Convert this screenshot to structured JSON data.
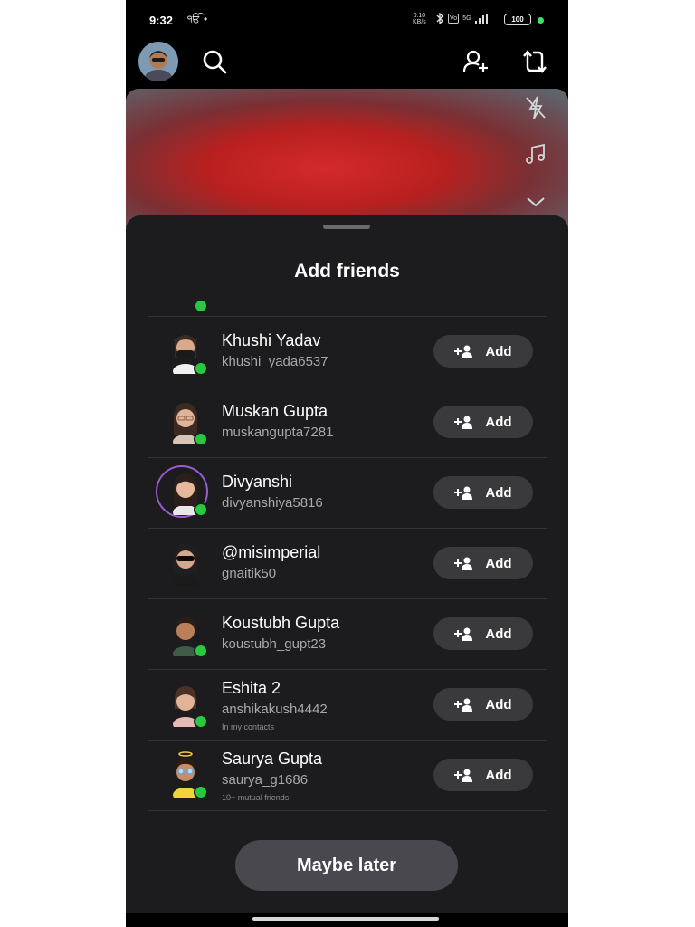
{
  "status_bar": {
    "time": "9:32",
    "left_icons": "ੴ •",
    "speed_top": "0.10",
    "speed_bottom": "KB/s",
    "network": "5G",
    "battery": "100"
  },
  "sheet": {
    "title": "Add friends",
    "add_label": "Add",
    "maybe_later": "Maybe later"
  },
  "friends": [
    {
      "name": "Khushi Yadav",
      "username": "khushi_yada6537",
      "meta": ""
    },
    {
      "name": "Muskan Gupta",
      "username": "muskangupta7281",
      "meta": ""
    },
    {
      "name": "Divyanshi",
      "username": "divyanshiya5816",
      "meta": ""
    },
    {
      "name": "@misimperial",
      "username": "gnaitik50",
      "meta": ""
    },
    {
      "name": "Koustubh Gupta",
      "username": "koustubh_gupt23",
      "meta": ""
    },
    {
      "name": "Eshita 2",
      "username": "anshikakush4442",
      "meta": "In my contacts"
    },
    {
      "name": "Saurya Gupta",
      "username": "saurya_g1686",
      "meta": "10+ mutual friends"
    }
  ],
  "colors": {
    "sheet_bg": "#1c1c1e",
    "online": "#28c840",
    "ring": "#9b59d0",
    "button_bg": "#3a3a3c"
  },
  "icons": [
    "search-icon",
    "add-friend-icon",
    "flip-camera-icon",
    "flash-off-icon",
    "music-icon",
    "chevron-down-icon"
  ]
}
